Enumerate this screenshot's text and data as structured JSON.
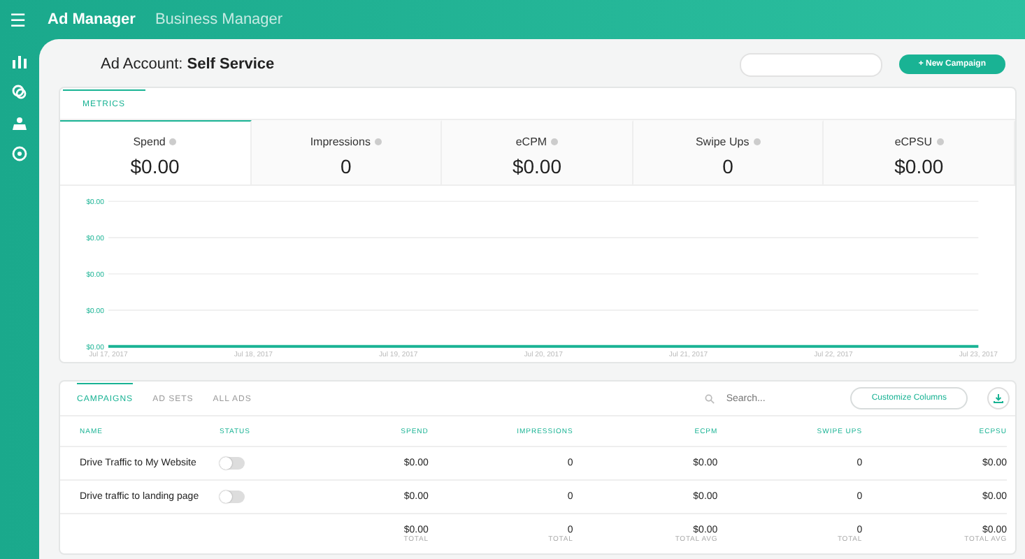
{
  "topbar": {
    "menu_icon": "☰",
    "nav": [
      {
        "label": "Ad Manager",
        "selected": true
      },
      {
        "label": "Business Manager",
        "selected": false
      }
    ]
  },
  "header": {
    "title_prefix": "Ad Account: ",
    "title_name": "Self Service",
    "new_button": "+ New Campaign"
  },
  "metrics_tab": "METRICS",
  "metrics": [
    {
      "label": "Spend",
      "value": "$0.00",
      "selected": true
    },
    {
      "label": "Impressions",
      "value": "0",
      "selected": false
    },
    {
      "label": "eCPM",
      "value": "$0.00",
      "selected": false
    },
    {
      "label": "Swipe Ups",
      "value": "0",
      "selected": false
    },
    {
      "label": "eCPSU",
      "value": "$0.00",
      "selected": false
    }
  ],
  "chart": {
    "x_labels": [
      "Jul 17, 2017",
      "Jul 18, 2017",
      "Jul 19, 2017",
      "Jul 20, 2017",
      "Jul 21, 2017",
      "Jul 22, 2017",
      "Jul 23, 2017"
    ],
    "y_labels": [
      "$0.00",
      "$0.00",
      "$0.00",
      "$0.00",
      "$0.00"
    ]
  },
  "table_tabs": [
    {
      "label": "CAMPAIGNS",
      "selected": true
    },
    {
      "label": "AD SETS",
      "selected": false
    },
    {
      "label": "ALL ADS",
      "selected": false
    }
  ],
  "search": {
    "placeholder": "Search..."
  },
  "customize_button": "Customize Columns",
  "columns": [
    "NAME",
    "STATUS",
    "SPEND",
    "IMPRESSIONS",
    "ECPM",
    "SWIPE UPS",
    "ECPSU"
  ],
  "rows": [
    {
      "name": "Drive Traffic to My Website",
      "on": false,
      "cells": [
        "$0.00",
        "0",
        "$0.00",
        "0",
        "$0.00"
      ]
    },
    {
      "name": "Drive traffic to landing page",
      "on": false,
      "cells": [
        "$0.00",
        "0",
        "$0.00",
        "0",
        "$0.00"
      ]
    }
  ],
  "totals": [
    {
      "value": "$0.00",
      "label": "TOTAL"
    },
    {
      "value": "0",
      "label": "TOTAL"
    },
    {
      "value": "$0.00",
      "label": "TOTAL AVG"
    },
    {
      "value": "0",
      "label": "TOTAL"
    },
    {
      "value": "$0.00",
      "label": "TOTAL AVG"
    }
  ]
}
